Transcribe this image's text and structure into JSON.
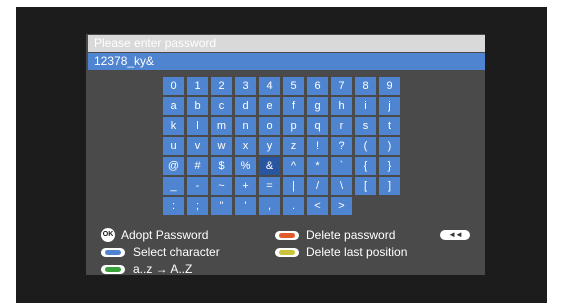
{
  "dialog": {
    "prompt": "Please enter password",
    "entered": "12378_ky&"
  },
  "keyboard": {
    "selected": "&",
    "rows": [
      [
        "0",
        "1",
        "2",
        "3",
        "4",
        "5",
        "6",
        "7",
        "8",
        "9"
      ],
      [
        "a",
        "b",
        "c",
        "d",
        "e",
        "f",
        "g",
        "h",
        "i",
        "j"
      ],
      [
        "k",
        "l",
        "m",
        "n",
        "o",
        "p",
        "q",
        "r",
        "s",
        "t"
      ],
      [
        "u",
        "v",
        "w",
        "x",
        "y",
        "z",
        "!",
        "?",
        "(",
        ")"
      ],
      [
        "@",
        "#",
        "$",
        "%",
        "&",
        "^",
        "*",
        "`",
        "{",
        "}"
      ],
      [
        "_",
        "-",
        "~",
        "+",
        "=",
        "|",
        "/",
        "\\",
        "[",
        "]"
      ],
      [
        ":",
        ";",
        "\"",
        "'",
        ",",
        ".",
        "<",
        ">"
      ]
    ]
  },
  "legend": {
    "ok_icon_text": "OK",
    "adopt": "Adopt Password",
    "select": "Select character",
    "case": "a..z → A..Z",
    "delete_password": "Delete password",
    "delete_last": "Delete last position",
    "rewind_icon_text": "◄◄"
  },
  "colors": {
    "red": "#e05a2a",
    "blue": "#4f84d0",
    "green": "#3aa13a",
    "yellow": "#c9c43a"
  }
}
